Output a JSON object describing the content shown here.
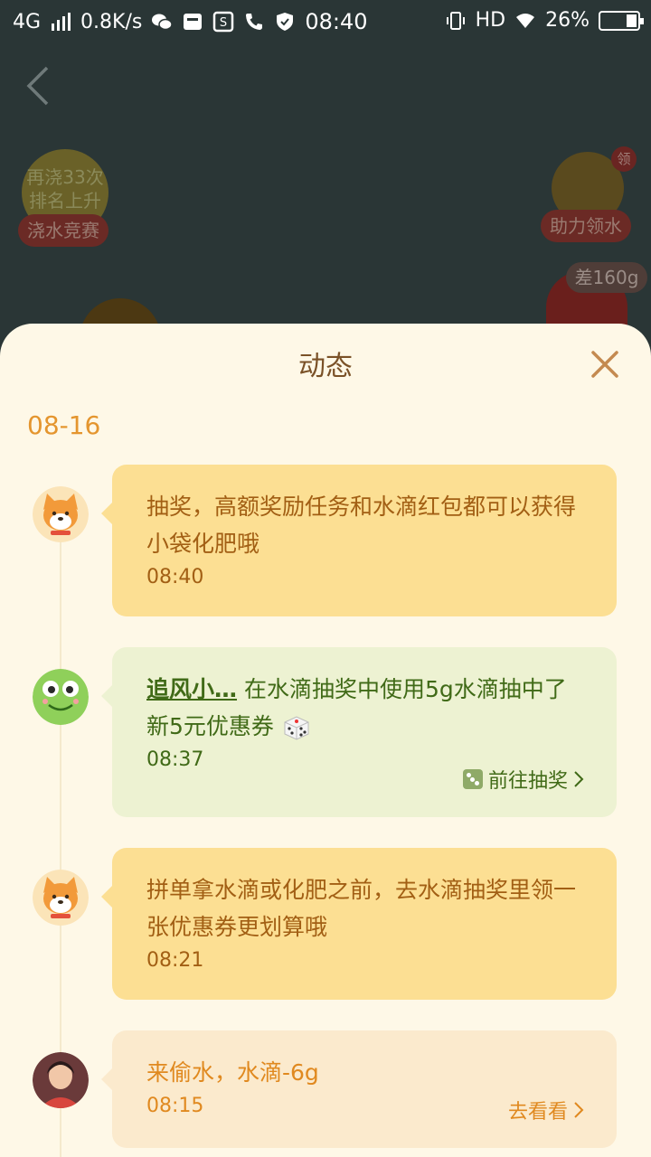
{
  "status_bar": {
    "network": "4G",
    "speed": "0.8K/s",
    "time": "08:40",
    "hd": "HD",
    "battery": "26%"
  },
  "background": {
    "water_race": {
      "line1": "再浇33次",
      "line2": "排名上升",
      "tag": "浇水竞赛"
    },
    "help_water": {
      "badge": "领",
      "tag": "助力领水"
    },
    "difference": "差160g"
  },
  "sheet": {
    "title": "动态",
    "date": "08-16",
    "entries": [
      {
        "type": "system",
        "message": "抽奖，高额奖励任务和水滴红包都可以获得小袋化肥哦",
        "time": "08:40"
      },
      {
        "type": "lottery",
        "user": "追风小…",
        "message": " 在水滴抽奖中使用5g水滴抽中了新5元优惠券",
        "time": "08:37",
        "action": "前往抽奖"
      },
      {
        "type": "system",
        "message": "拼单拿水滴或化肥之前，去水滴抽奖里领一张优惠券更划算哦",
        "time": "08:21"
      },
      {
        "type": "steal",
        "message": "来偷水，水滴-6g",
        "time": "08:15",
        "action": "去看看"
      }
    ]
  },
  "colors": {
    "sheet_bg": "#fef8e7",
    "yellow_bubble": "#fcdf93",
    "green_bubble": "#edf2d2",
    "beige_bubble": "#fbeacd",
    "accent_orange": "#e4952e"
  }
}
